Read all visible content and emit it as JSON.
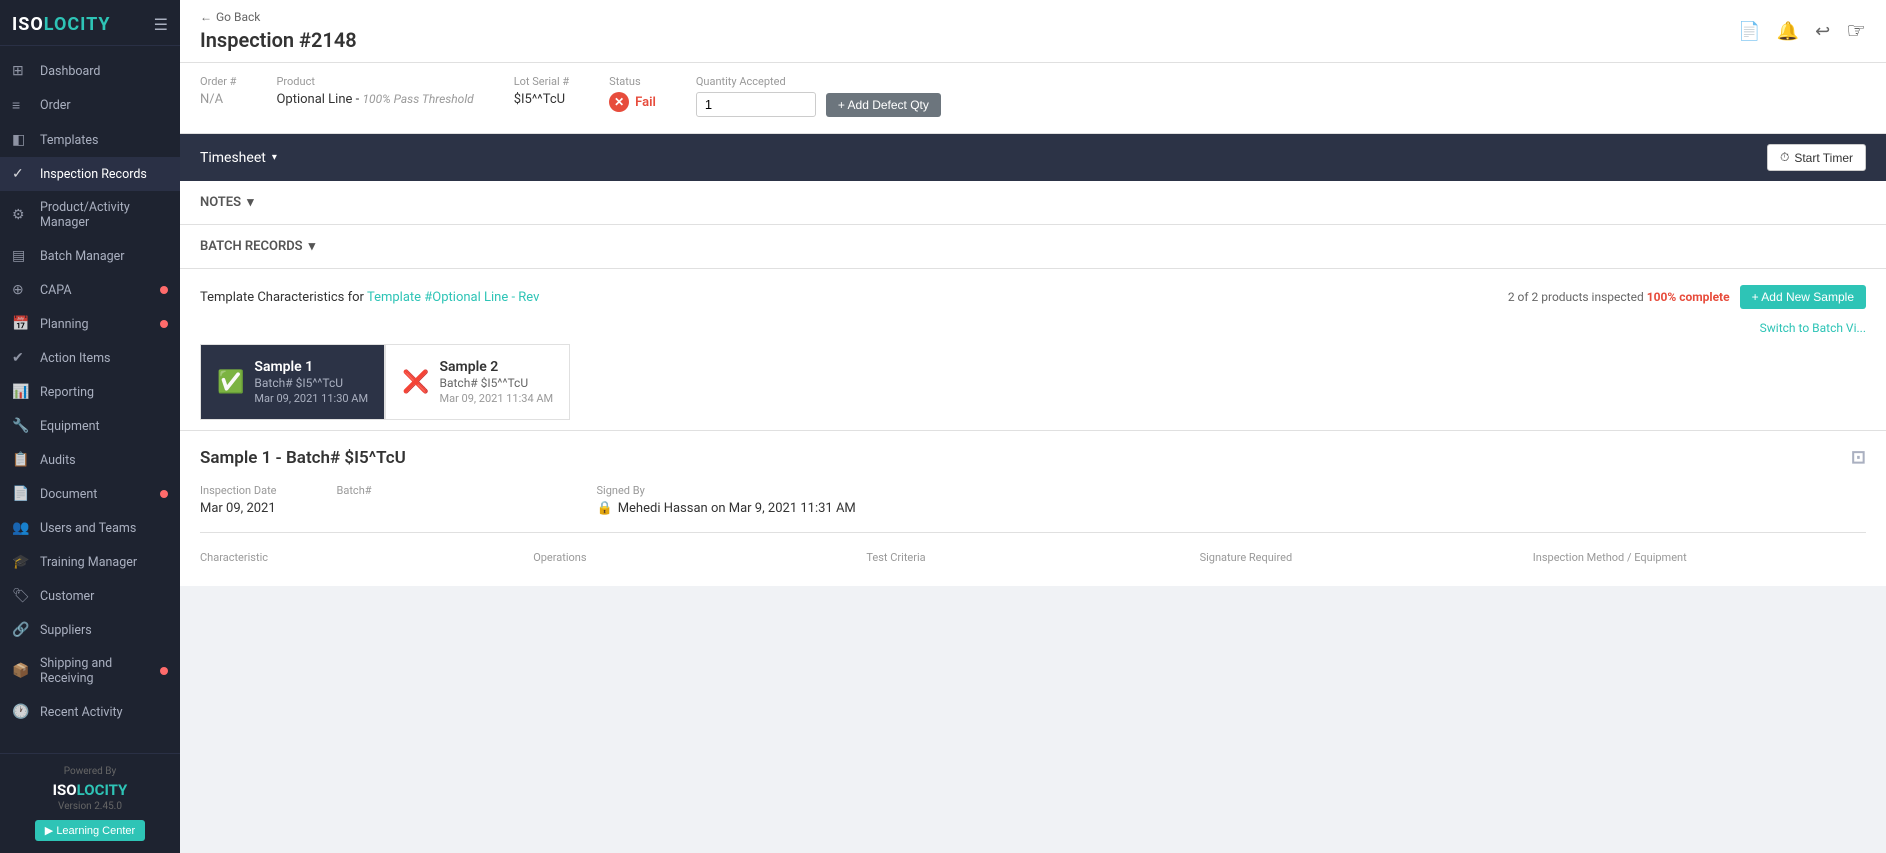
{
  "app": {
    "name_iso": "ISO",
    "name_locity": "LOCITY",
    "version": "Version 2.45.0",
    "learning_center": "▶ Learning Center",
    "powered_by": "Powered By"
  },
  "sidebar": {
    "items": [
      {
        "id": "dashboard",
        "label": "Dashboard",
        "icon": "⊞",
        "active": false,
        "badge": false
      },
      {
        "id": "order",
        "label": "Order",
        "icon": "≡",
        "active": false,
        "badge": false
      },
      {
        "id": "templates",
        "label": "Templates",
        "icon": "◧",
        "active": false,
        "badge": false
      },
      {
        "id": "inspection-records",
        "label": "Inspection Records",
        "icon": "✓",
        "active": true,
        "badge": false
      },
      {
        "id": "product-activity-manager",
        "label": "Product/Activity Manager",
        "icon": "⚙",
        "active": false,
        "badge": false
      },
      {
        "id": "batch-manager",
        "label": "Batch Manager",
        "icon": "▤",
        "active": false,
        "badge": false
      },
      {
        "id": "capa",
        "label": "CAPA",
        "icon": "⊕",
        "active": false,
        "badge": true
      },
      {
        "id": "planning",
        "label": "Planning",
        "icon": "📅",
        "active": false,
        "badge": true
      },
      {
        "id": "action-items",
        "label": "Action Items",
        "icon": "✔",
        "active": false,
        "badge": false
      },
      {
        "id": "reporting",
        "label": "Reporting",
        "icon": "📊",
        "active": false,
        "badge": false
      },
      {
        "id": "equipment",
        "label": "Equipment",
        "icon": "🔧",
        "active": false,
        "badge": false
      },
      {
        "id": "audits",
        "label": "Audits",
        "icon": "📋",
        "active": false,
        "badge": false
      },
      {
        "id": "document",
        "label": "Document",
        "icon": "📄",
        "active": false,
        "badge": true
      },
      {
        "id": "users-and-teams",
        "label": "Users and Teams",
        "icon": "👥",
        "active": false,
        "badge": false
      },
      {
        "id": "training-manager",
        "label": "Training Manager",
        "icon": "🎓",
        "active": false,
        "badge": false
      },
      {
        "id": "customer",
        "label": "Customer",
        "icon": "🏷",
        "active": false,
        "badge": false
      },
      {
        "id": "suppliers",
        "label": "Suppliers",
        "icon": "🔗",
        "active": false,
        "badge": false
      },
      {
        "id": "shipping-and-receiving",
        "label": "Shipping and Receiving",
        "icon": "📦",
        "active": false,
        "badge": true
      },
      {
        "id": "recent-activity",
        "label": "Recent Activity",
        "icon": "🕐",
        "active": false,
        "badge": false
      }
    ]
  },
  "topbar": {
    "go_back_label": "← Go Back",
    "page_title": "Inspection #2148",
    "icons": {
      "document": "📄",
      "bell": "🔔",
      "history": "↩"
    }
  },
  "info_bar": {
    "order_label": "Order #",
    "order_value": "N/A",
    "product_label": "Product",
    "product_value": "Optional Line",
    "product_threshold": "100% Pass Threshold",
    "lot_serial_label": "Lot Serial #",
    "lot_serial_value": "$I5^^TcU",
    "status_label": "Status",
    "status_value": "Fail",
    "qty_accepted_label": "Quantity Accepted",
    "qty_accepted_value": "1",
    "add_defect_label": "+ Add Defect Qty"
  },
  "timesheet": {
    "label": "Timesheet",
    "start_timer_label": "Start Timer",
    "timer_icon": "⏱"
  },
  "sections": {
    "notes_label": "NOTES",
    "batch_records_label": "BATCH RECORDS"
  },
  "template_section": {
    "title_prefix": "Template Characteristics for",
    "template_link": "Template #Optional Line - Rev",
    "stats_text": "2 of 2 products inspected",
    "stats_pct": "100% complete",
    "add_sample_label": "+ Add New Sample",
    "switch_view": "Switch to Batch Vi..."
  },
  "samples": [
    {
      "id": "sample-1",
      "name": "Sample 1",
      "batch": "Batch# $I5^^TcU",
      "date": "Mar 09, 2021 11:30 AM",
      "status": "pass",
      "active": true
    },
    {
      "id": "sample-2",
      "name": "Sample 2",
      "batch": "Batch# $I5^^TcU",
      "date": "Mar 09, 2021 11:34 AM",
      "status": "fail",
      "active": false
    }
  ],
  "sample_detail": {
    "title": "Sample 1 - Batch# $I5^TcU",
    "inspection_date_label": "Inspection Date",
    "inspection_date_value": "Mar 09, 2021",
    "batch_label": "Batch#",
    "batch_value": "",
    "signed_by_label": "Signed By",
    "signed_by_value": "Mehedi Hassan on Mar 9, 2021 11:31 AM"
  },
  "char_table": {
    "headers": [
      "Characteristic",
      "Operations",
      "Test Criteria",
      "Signature Required",
      "Inspection Method / Equipment"
    ]
  }
}
